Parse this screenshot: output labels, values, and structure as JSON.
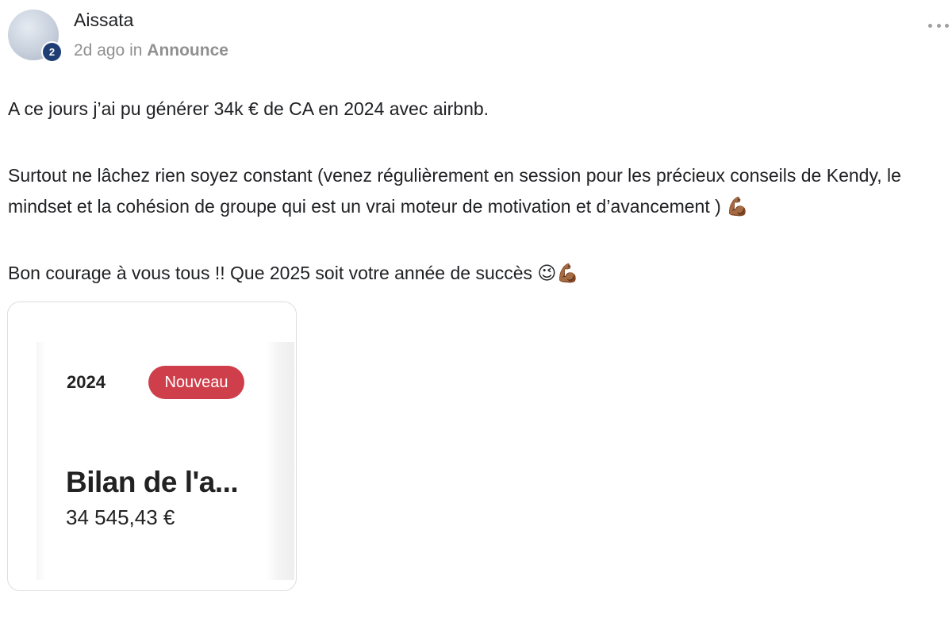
{
  "post": {
    "author": "Aissata",
    "level": "2",
    "time": "2d ago",
    "in_word": "in",
    "category": "Announce",
    "paragraphs": [
      "A ce jours j’ai pu générer 34k € de CA en 2024 avec airbnb.",
      "Surtout ne lâchez rien soyez constant (venez régulièrement en session pour les précieux conseils de Kendy, le mindset et la cohésion de groupe qui est un vrai moteur de motivation et d’avancement ) 💪🏾",
      "Bon courage à vous tous !! Que 2025 soit votre année de succès 😉💪🏾"
    ]
  },
  "attachment": {
    "year": "2024",
    "badge": "Nouveau",
    "title": "Bilan de l'a...",
    "amount": "34 545,43 €"
  },
  "icons": {
    "more": "more-horizontal-icon"
  },
  "colors": {
    "badge": "#cf3f4b",
    "level_badge": "#1f3f74",
    "meta_text": "#909090"
  }
}
